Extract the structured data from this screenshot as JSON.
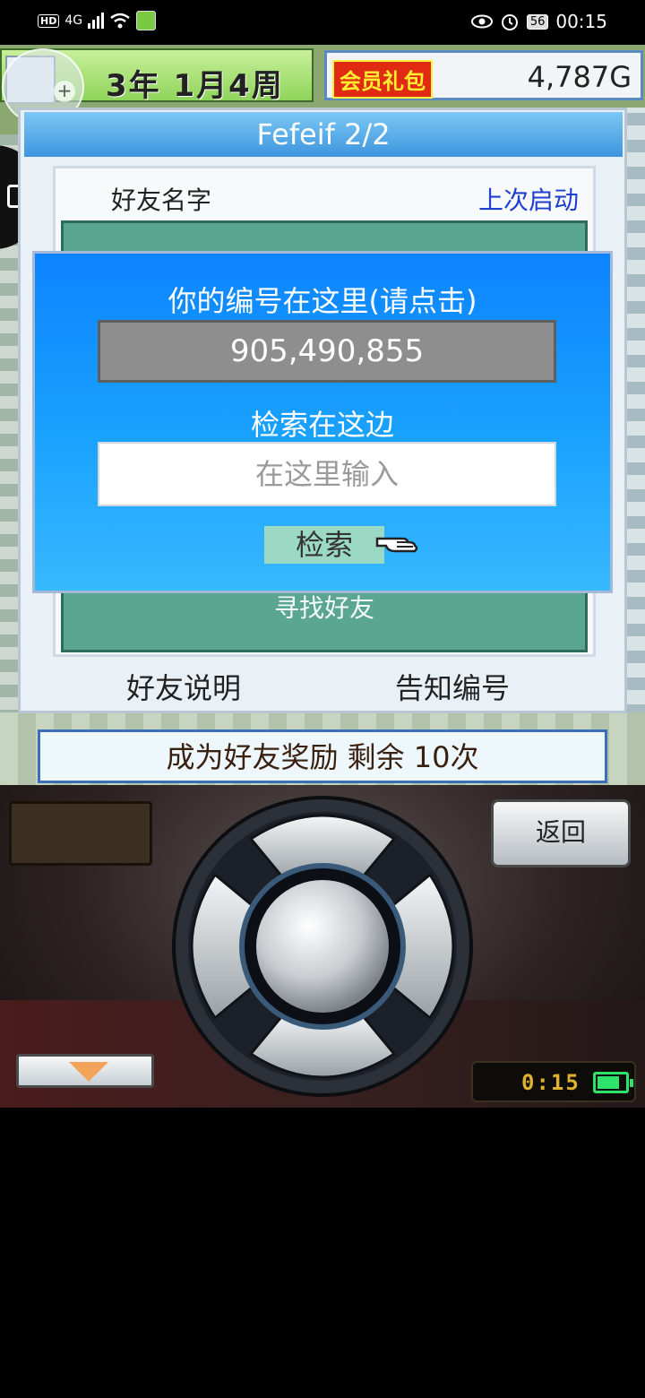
{
  "status_bar": {
    "network": "4G",
    "battery": "56",
    "time": "00:15"
  },
  "game": {
    "date": "3年 1月4周",
    "vip_label": "会员礼包",
    "money": "4,787G"
  },
  "friends_panel": {
    "title": "Fefeif 2/2",
    "col_name": "好友名字",
    "col_last_launch": "上次启动",
    "find_friends": "寻找好友",
    "explain_button": "好友说明",
    "notify_button": "告知编号"
  },
  "modal": {
    "id_title": "你的编号在这里(请点击)",
    "id_value": "905,490,855",
    "search_title": "检索在这边",
    "search_placeholder": "在这里输入",
    "search_button": "检索"
  },
  "reward_banner": "成为好友奖励 剩余 10次",
  "controller": {
    "back_button": "返回",
    "clock": "0:15",
    "battery_level": 0.7
  }
}
